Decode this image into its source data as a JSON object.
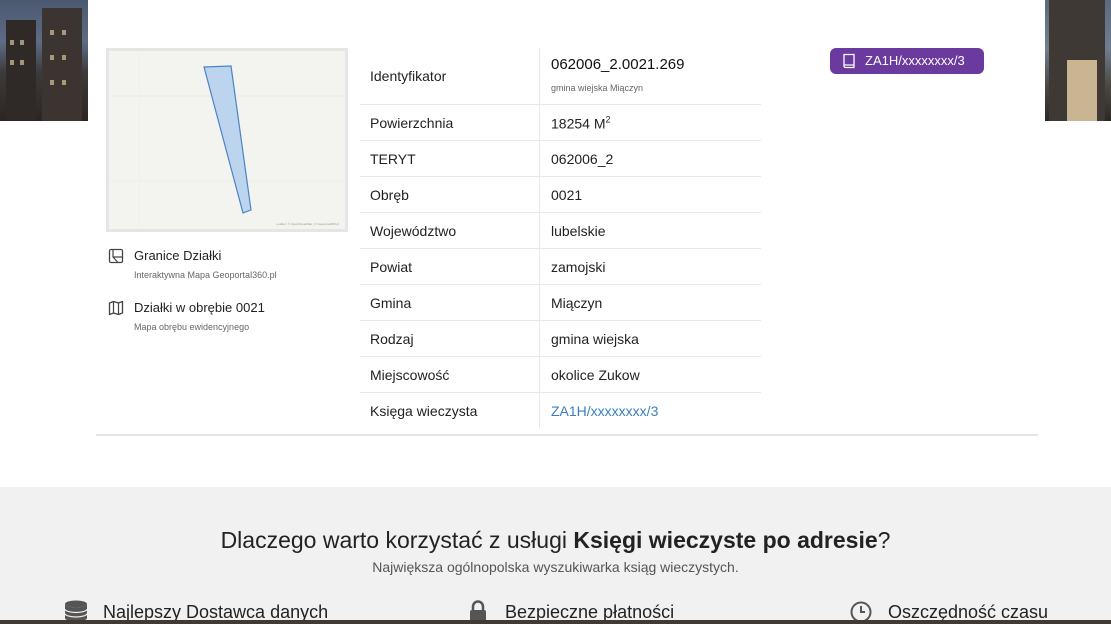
{
  "map": {
    "attribution": "Leaflet | © OpenStreetMap | © Geoportal360.pl"
  },
  "side_links": [
    {
      "title": "Granice Działki",
      "subtitle": "Interaktywna Mapa Geoportal360.pl",
      "icon": "map-outline-icon"
    },
    {
      "title": "Działki w obrębie 0021",
      "subtitle": "Mapa obrębu ewidencyjnego",
      "icon": "folded-map-icon"
    }
  ],
  "details": {
    "identyfikator": {
      "label": "Identyfikator",
      "value": "062006_2.0021.269",
      "sub": "gmina wiejska Miączyn"
    },
    "powierzchnia": {
      "label": "Powierzchnia",
      "value": "18254 M",
      "unit_sup": "2"
    },
    "rows": [
      {
        "label": "TERYT",
        "value": "062006_2"
      },
      {
        "label": "Obręb",
        "value": "0021"
      },
      {
        "label": "Województwo",
        "value": "lubelskie"
      },
      {
        "label": "Powiat",
        "value": "zamojski"
      },
      {
        "label": "Gmina",
        "value": "Miączyn"
      },
      {
        "label": "Rodzaj",
        "value": "gmina wiejska"
      },
      {
        "label": "Miejscowość",
        "value": "okolice Zukow"
      }
    ],
    "ksiega": {
      "label": "Księga wieczysta",
      "value": "ZA1H/xxxxxxxx/3"
    }
  },
  "badge": {
    "label": "ZA1H/xxxxxxxx/3",
    "icon": "book-icon",
    "color": "#6b3a9e"
  },
  "why": {
    "heading_prefix": "Dlaczego warto korzystać z usługi ",
    "heading_bold": "Księgi wieczyste po adresie",
    "heading_suffix": "?",
    "subheading": "Największa ogólnopolska wyszukiwarka ksiąg wieczystych.",
    "features": [
      {
        "label": "Najlepszy Dostawca danych",
        "icon": "database-icon"
      },
      {
        "label": "Bezpieczne płatności",
        "icon": "lock-icon"
      },
      {
        "label": "Oszczędność czasu",
        "icon": "clock-icon"
      }
    ]
  },
  "colors": {
    "accent": "#6b3a9e",
    "link": "#3a7fc1",
    "parcel_fill": "#bcd4ee",
    "parcel_stroke": "#4a84c4"
  }
}
